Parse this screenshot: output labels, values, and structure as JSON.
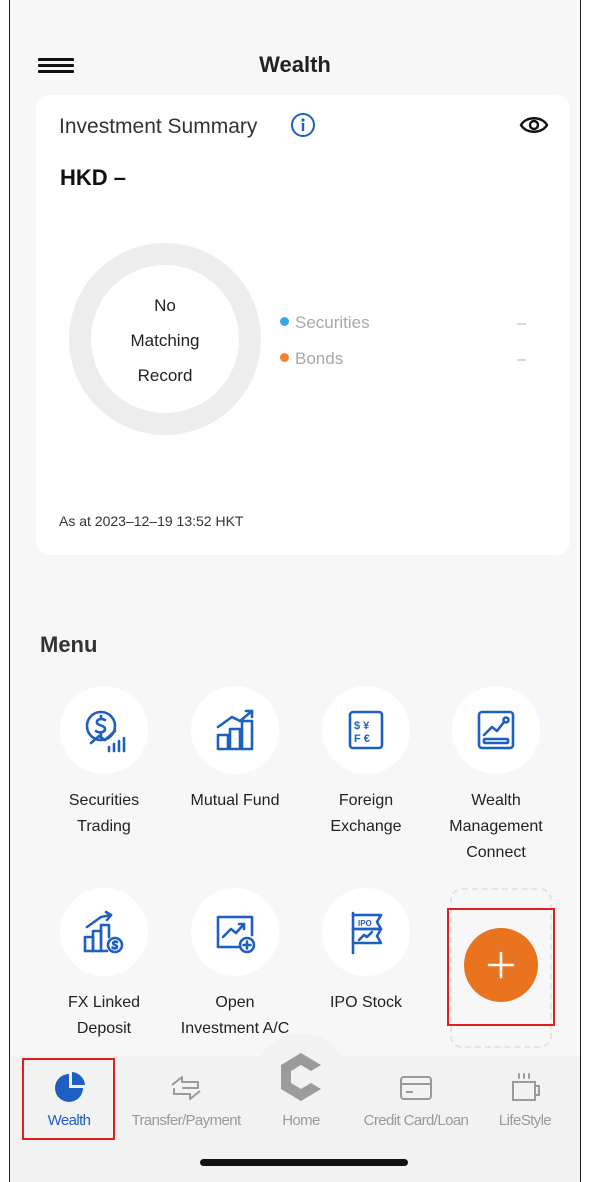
{
  "header": {
    "title": "Wealth"
  },
  "summary": {
    "title": "Investment Summary",
    "currency": "HKD –",
    "donut_text": [
      "No",
      "Matching",
      "Record"
    ],
    "legend": [
      {
        "label": "Securities",
        "value": "–",
        "color": "#3aa8e8"
      },
      {
        "label": "Bonds",
        "value": "–",
        "color": "#f0822e"
      }
    ],
    "as_at": "As at 2023–12–19 13:52 HKT"
  },
  "menu": {
    "heading": "Menu",
    "items": [
      {
        "label": "Securities\nTrading",
        "icon": "securities-trading-icon"
      },
      {
        "label": "Mutual Fund",
        "icon": "mutual-fund-icon"
      },
      {
        "label": "Foreign\nExchange",
        "icon": "foreign-exchange-icon"
      },
      {
        "label": "Wealth\nManagement\nConnect",
        "icon": "wealth-management-connect-icon"
      },
      {
        "label": "FX Linked\nDeposit",
        "icon": "fx-linked-deposit-icon"
      },
      {
        "label": "Open\nInvestment A/C",
        "icon": "open-investment-icon"
      },
      {
        "label": "IPO Stock",
        "icon": "ipo-stock-icon"
      }
    ],
    "add_icon": "plus-icon"
  },
  "bottom_nav": {
    "items": [
      {
        "label": "Wealth",
        "icon": "pie-chart-icon",
        "active": true
      },
      {
        "label": "Transfer/Payment",
        "icon": "transfer-arrows-icon",
        "active": false
      },
      {
        "label": "Home",
        "icon": "bank-logo-icon",
        "active": false
      },
      {
        "label": "Credit Card/Loan",
        "icon": "credit-card-icon",
        "active": false
      },
      {
        "label": "LifeStyle",
        "icon": "coffee-cup-icon",
        "active": false
      }
    ]
  },
  "colors": {
    "accent_blue": "#1e5fc2",
    "orange": "#e9731e",
    "highlight_red": "#e02020"
  }
}
